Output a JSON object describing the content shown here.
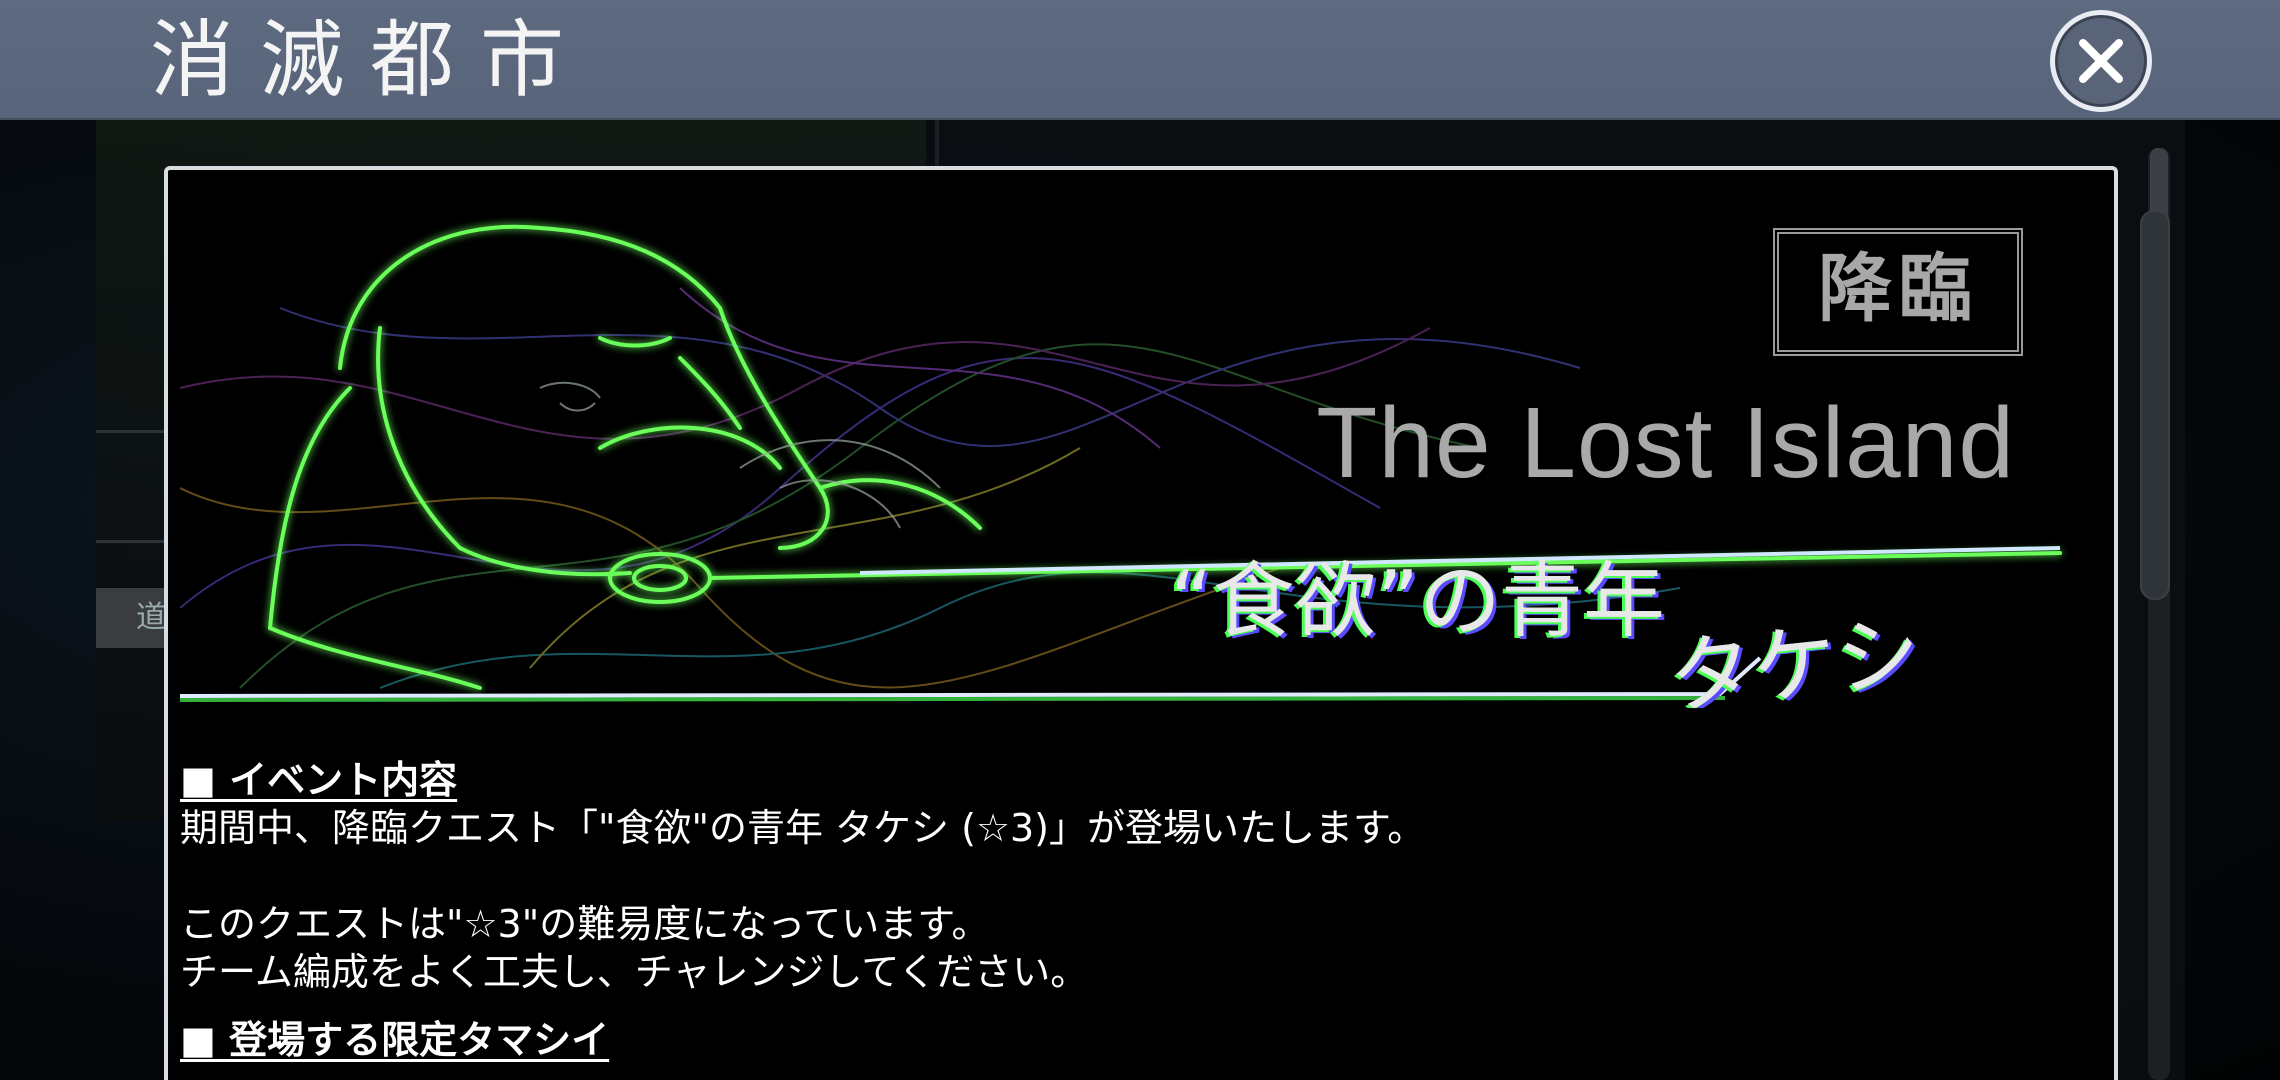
{
  "header": {
    "title": "消滅都市",
    "close_icon": "close-icon"
  },
  "background": {
    "tab_label": "道"
  },
  "banner": {
    "stamp": "降臨",
    "subtitle_en": "The Lost Island",
    "name_line1": "“食欲”の青年",
    "name_line2": "タケシ"
  },
  "content": {
    "section1_heading": "■ イベント内容",
    "section1_text": "期間中、降臨クエスト「\"食欲\"の青年 タケシ (☆3)」が登場いたします。",
    "section1_text2": "このクエストは\"☆3\"の難易度になっています。\nチーム編成をよく工夫し、チャレンジしてください。",
    "section2_heading": "■ 登場する限定タマシイ"
  },
  "colors": {
    "header_bg": "#5d6a80",
    "glow_green": "#4aff55",
    "glow_blue": "#5b4bff"
  }
}
